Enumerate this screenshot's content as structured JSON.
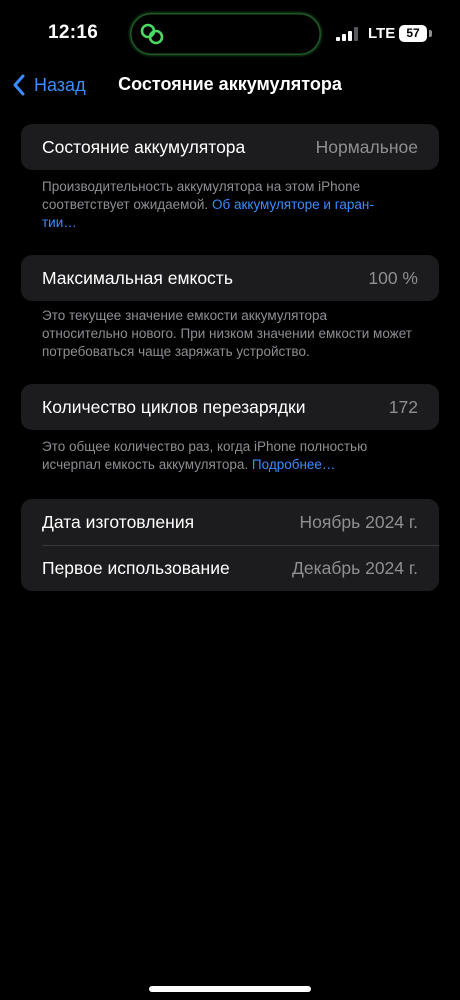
{
  "status_bar": {
    "time": "12:16",
    "network": "LTE",
    "battery_level": "57"
  },
  "nav": {
    "back_label": "Назад",
    "title": "Состояние аккумулятора"
  },
  "battery_state": {
    "label": "Состояние аккумулятора",
    "value": "Нормальное",
    "footnote_text": "Производительность аккумулятора на этом iPhone соответствует ожидаемой. ",
    "footnote_link": "Об аккумуляторе и гаран-\nтии…"
  },
  "max_capacity": {
    "label": "Максимальная емкость",
    "value": "100 %",
    "footnote_text": "Это текущее значение емкости аккумулятора относительно нового. При низком значении емкости может потребоваться чаще заряжать устройство."
  },
  "cycle_count": {
    "label": "Количество циклов перезарядки",
    "value": "172",
    "footnote_text": "Это общее количество раз, когда iPhone полностью исчерпал емкость аккумулятора. ",
    "footnote_link": "Подробнее…"
  },
  "dates": {
    "manufacture_label": "Дата изготовления",
    "manufacture_value": "Ноябрь 2024 г.",
    "first_use_label": "Первое использование",
    "first_use_value": "Декабрь 2024 г."
  },
  "colors": {
    "background": "#000000",
    "cell": "#1c1c1e",
    "accent_link": "#3a8dff",
    "secondary_text": "#8e8e93"
  }
}
